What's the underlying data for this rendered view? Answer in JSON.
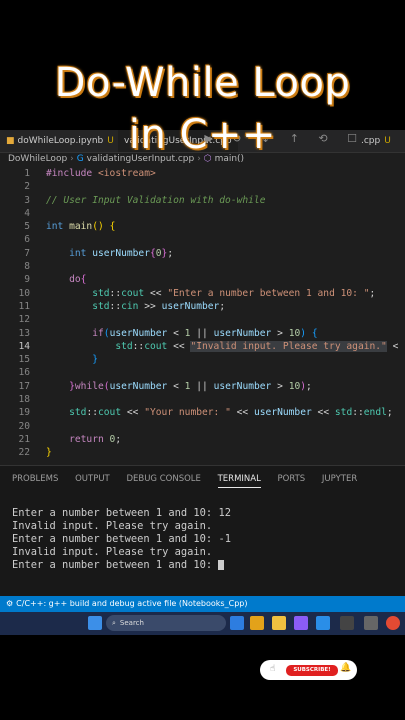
{
  "overlay_title": {
    "line1": "Do-While Loop",
    "line2": "in C++"
  },
  "tabs": [
    {
      "label": "doWhileLoop.ipynb",
      "modified": "U"
    },
    {
      "label": "validatingUserInput.cpp",
      "modified": "U"
    },
    {
      "label": ".cpp",
      "modified": "U"
    }
  ],
  "breadcrumb": {
    "folder": "DoWhileLoop",
    "file": "validatingUserInput.cpp",
    "symbol": "main()"
  },
  "code_lines": [
    "1",
    "2",
    "3",
    "4",
    "5",
    "6",
    "7",
    "8",
    "9",
    "10",
    "11",
    "12",
    "13",
    "14",
    "15",
    "16",
    "17",
    "18",
    "19",
    "20",
    "21",
    "22"
  ],
  "code": {
    "include_kw": "#include",
    "include_lib": "<iostream>",
    "comment": "// User Input Validation with do-while",
    "main_sig": "main",
    "int": "int",
    "var": "userNumber",
    "init_val": "0",
    "do": "do",
    "prompt": "\"Enter a number between 1 and 10: \"",
    "invalid": "\"Invalid input. Please try again.\"",
    "your_number": "\"Your number: \"",
    "while": "while",
    "if": "if",
    "return": "return",
    "ret_val": "0",
    "lower": "1",
    "upper": "10"
  },
  "panel_tabs": [
    "PROBLEMS",
    "OUTPUT",
    "DEBUG CONSOLE",
    "TERMINAL",
    "PORTS",
    "JUPYTER"
  ],
  "terminal": [
    "Enter a number between 1 and 10: 12",
    "Invalid input. Please try again.",
    "Enter a number between 1 and 10: -1",
    "Invalid input. Please try again.",
    "Enter a number between 1 and 10: "
  ],
  "status_text": "C/C++: g++ build and debug active file (Notebooks_Cpp)",
  "taskbar": {
    "search_placeholder": "Search"
  },
  "subscribe_label": "SUBSCRIBE!"
}
